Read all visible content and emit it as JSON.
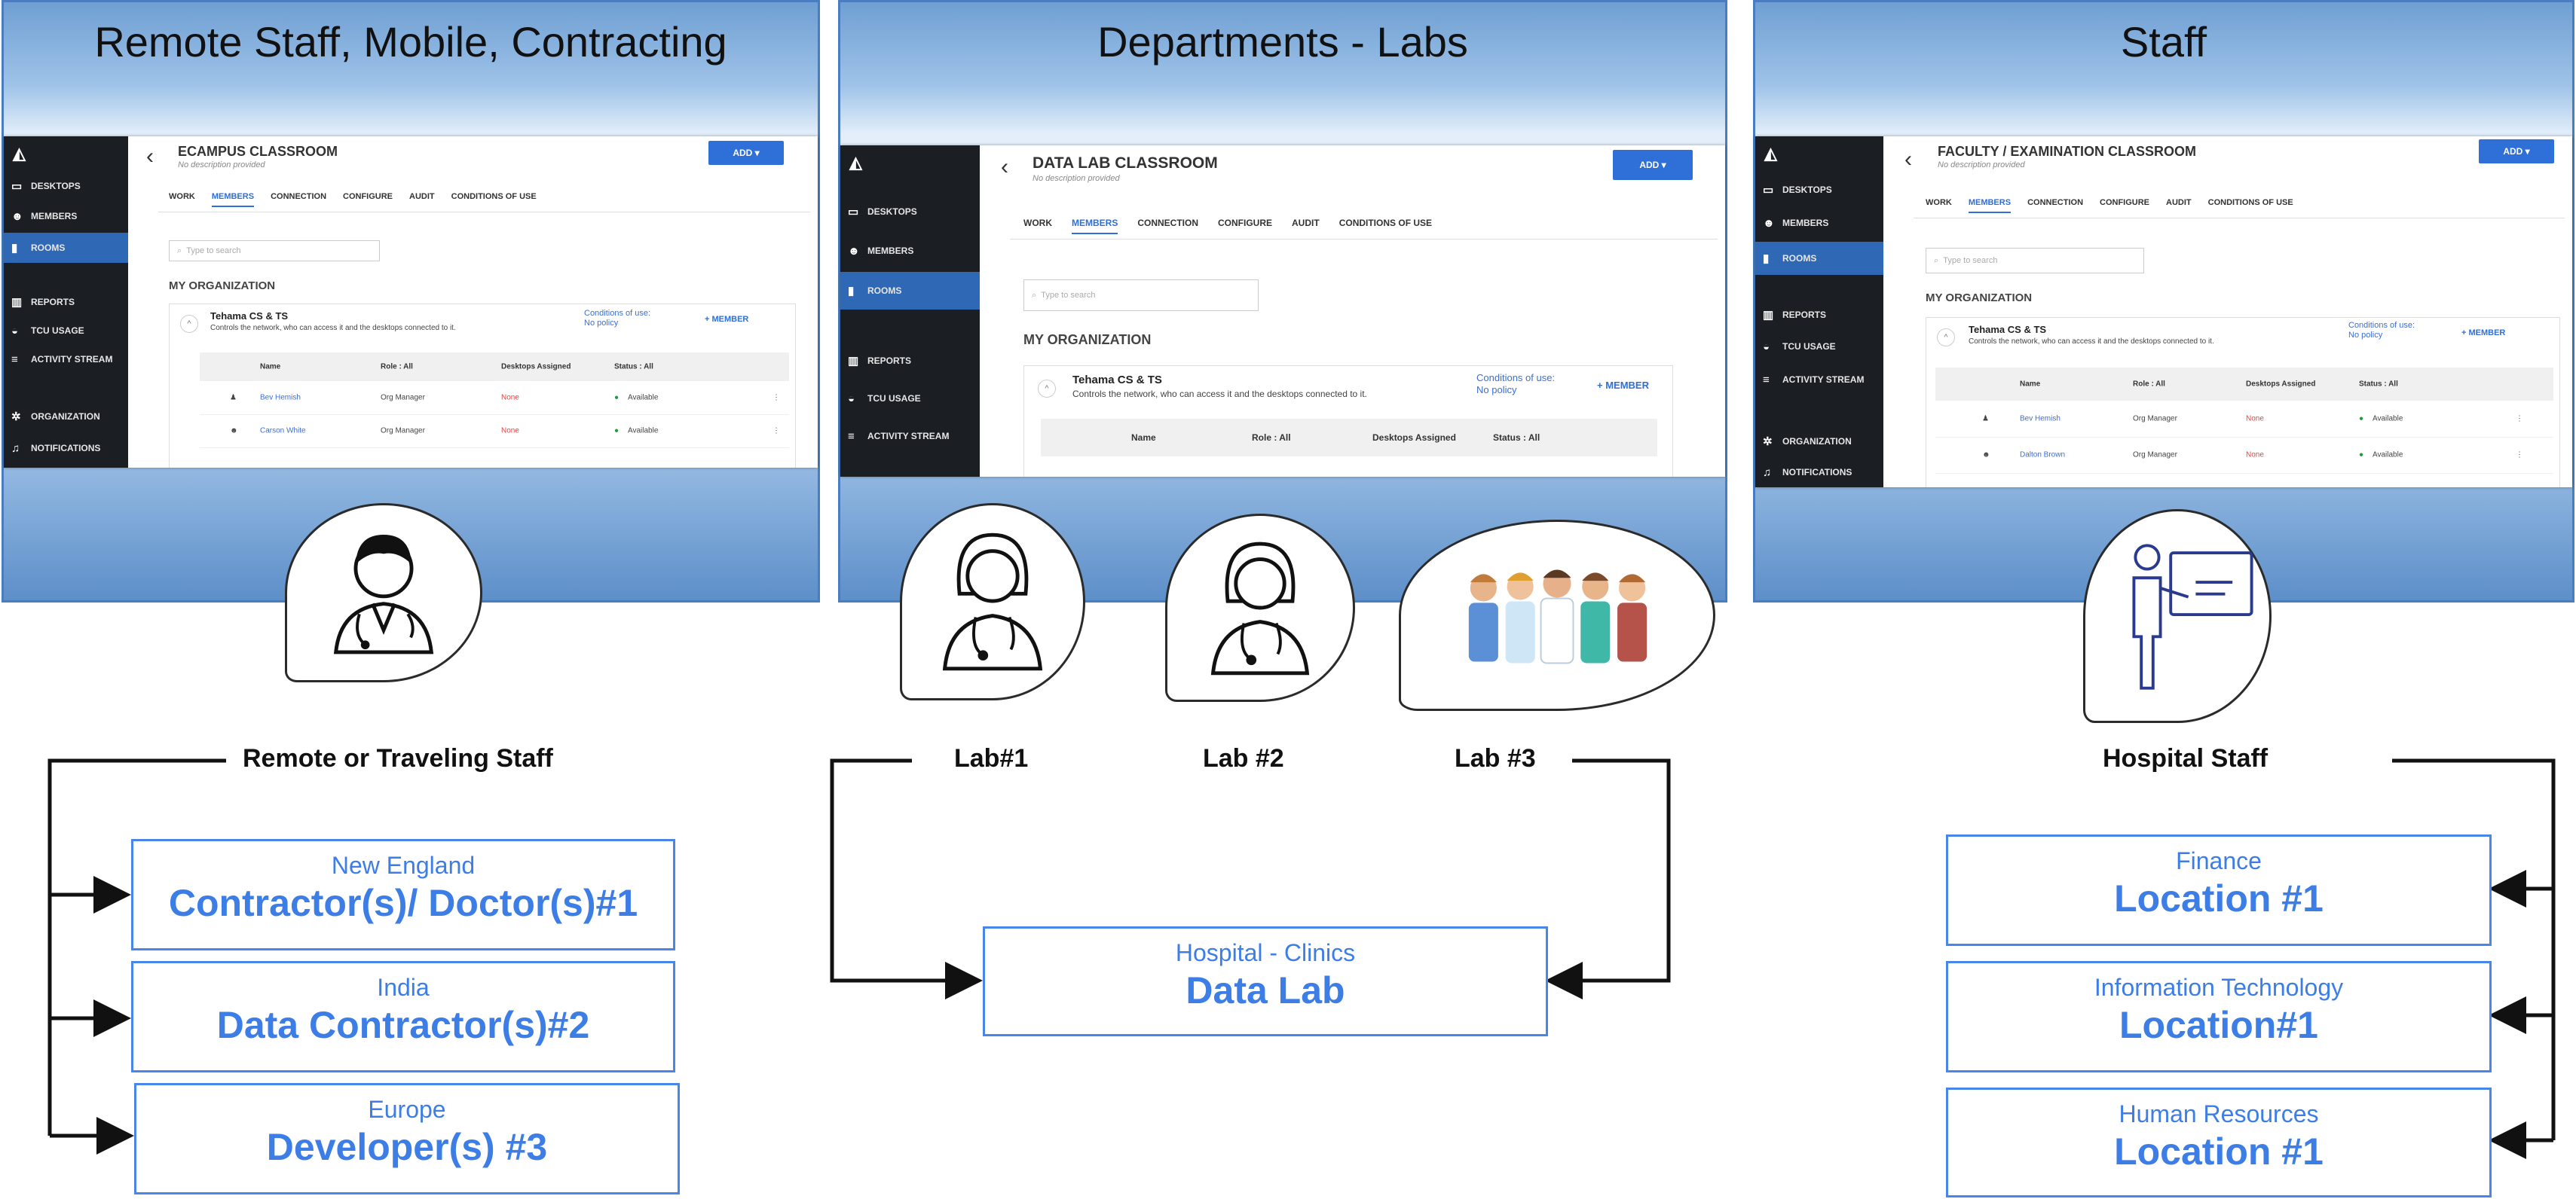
{
  "panels": [
    {
      "title": "Remote Staff, Mobile, Contracting",
      "screenshot": {
        "class_title": "ECAMPUS CLASSROOM",
        "subtitle": "No description provided",
        "add_label": "ADD",
        "sidebar": [
          "DESKTOPS",
          "MEMBERS",
          "ROOMS",
          "REPORTS",
          "TCU USAGE",
          "ACTIVITY STREAM",
          "ORGANIZATION",
          "NOTIFICATIONS"
        ],
        "tabs": [
          "WORK",
          "MEMBERS",
          "CONNECTION",
          "CONFIGURE",
          "AUDIT",
          "CONDITIONS OF USE"
        ],
        "search_placeholder": "Type to search",
        "org_heading": "MY ORGANIZATION",
        "group_name": "Tehama CS & TS",
        "group_desc": "Controls the network, who can access it and the desktops connected to it.",
        "conditions": "Conditions of use: No policy",
        "add_member": "+ MEMBER",
        "columns": [
          "Name",
          "Role : All",
          "Desktops Assigned",
          "Status : All"
        ],
        "rows": [
          {
            "name": "Bev Hemish",
            "role": "Org Manager",
            "desktops": "None",
            "status": "Available"
          },
          {
            "name": "Carson White",
            "role": "Org Manager",
            "desktops": "None",
            "status": "Available"
          }
        ]
      }
    },
    {
      "title": "Departments - Labs",
      "screenshot": {
        "class_title": "DATA LAB CLASSROOM",
        "subtitle": "No description provided",
        "add_label": "ADD",
        "sidebar": [
          "DESKTOPS",
          "MEMBERS",
          "ROOMS",
          "REPORTS",
          "TCU USAGE",
          "ACTIVITY STREAM"
        ],
        "tabs": [
          "WORK",
          "MEMBERS",
          "CONNECTION",
          "CONFIGURE",
          "AUDIT",
          "CONDITIONS OF USE"
        ],
        "search_placeholder": "Type to search",
        "org_heading": "MY ORGANIZATION",
        "group_name": "Tehama CS & TS",
        "group_desc": "Controls the network, who can access it and the desktops connected to it.",
        "conditions": "Conditions of use: No policy",
        "add_member": "+ MEMBER",
        "columns": [
          "Name",
          "Role : All",
          "Desktops Assigned",
          "Status : All"
        ],
        "rows": []
      }
    },
    {
      "title": "Staff",
      "screenshot": {
        "class_title": "FACULTY / EXAMINATION CLASSROOM",
        "subtitle": "No description provided",
        "add_label": "ADD",
        "sidebar": [
          "DESKTOPS",
          "MEMBERS",
          "ROOMS",
          "REPORTS",
          "TCU USAGE",
          "ACTIVITY STREAM",
          "ORGANIZATION",
          "NOTIFICATIONS"
        ],
        "tabs": [
          "WORK",
          "MEMBERS",
          "CONNECTION",
          "CONFIGURE",
          "AUDIT",
          "CONDITIONS OF USE"
        ],
        "search_placeholder": "Type to search",
        "org_heading": "MY ORGANIZATION",
        "group_name": "Tehama CS & TS",
        "group_desc": "Controls the network, who can access it and the desktops connected to it.",
        "conditions": "Conditions of use: No policy",
        "add_member": "+ MEMBER",
        "columns": [
          "Name",
          "Role : All",
          "Desktops Assigned",
          "Status : All"
        ],
        "rows": [
          {
            "name": "Bev Hemish",
            "role": "Org Manager",
            "desktops": "None",
            "status": "Available"
          },
          {
            "name": "Dalton Brown",
            "role": "Org Manager",
            "desktops": "None",
            "status": "Available"
          }
        ]
      }
    }
  ],
  "labels": {
    "remote": "Remote or Traveling Staff",
    "lab1": "Lab#1",
    "lab2": "Lab #2",
    "lab3": "Lab #3",
    "hospital": "Hospital Staff"
  },
  "remote_boxes": [
    {
      "region": "New England",
      "title": "Contractor(s)/ Doctor(s)#1"
    },
    {
      "region": "India",
      "title": "Data Contractor(s)#2"
    },
    {
      "region": "Europe",
      "title": "Developer(s) #3"
    }
  ],
  "lab_box": {
    "region": "Hospital - Clinics",
    "title": "Data Lab"
  },
  "staff_boxes": [
    {
      "region": "Finance",
      "title": "Location #1"
    },
    {
      "region": "Information Technology",
      "title": "Location#1"
    },
    {
      "region": "Human Resources",
      "title": "Location #1"
    }
  ],
  "colors": {
    "box_border": "#4a86e8",
    "box_text": "#3d7ee6",
    "panel_border": "#4a7cc0",
    "sidebar": "#1b1f24"
  }
}
